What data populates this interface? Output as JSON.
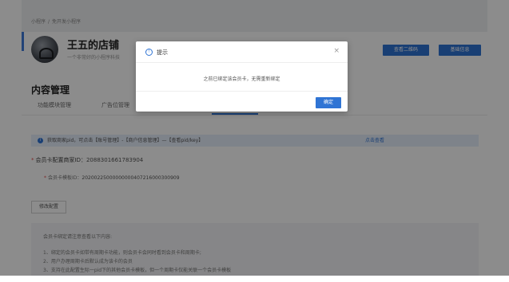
{
  "breadcrumb": {
    "root": "小程序",
    "separator": "/",
    "current": "免开发小程序"
  },
  "profile": {
    "store_name": "王五的店铺",
    "description": "一个非常好的小程序科技",
    "qr_button": "查看二维码",
    "info_button": "基础信息"
  },
  "content": {
    "title": "内容管理",
    "tabs": [
      {
        "label": "功能模块管理"
      },
      {
        "label": "广告位管理"
      }
    ],
    "notice": {
      "text": "获取商家pid，可点击【账号管理】-【商户信息管理】—【查看pid/key】",
      "link": "点击查看"
    },
    "fields": {
      "merchant_label": "会员卡配置商家ID：",
      "merchant_value": "2088301661783904",
      "template_label": "会员卡模板ID：",
      "template_value": "20200225000000000407216000300909"
    },
    "edit_button": "修改配置",
    "notes": {
      "title": "会员卡绑定请注意查看以下内容:",
      "items": [
        "1、绑定的会员卡如带有周期卡功能，则会员卡会同时看到会员卡和周期卡;",
        "2、用户办理周期卡后默认成为该卡的会员",
        "3、支持在此配置生际一pid下的其他会员卡模板，但一个周期卡仅能关联一个会员卡模板"
      ]
    }
  },
  "dialog": {
    "icon": "info-circle-icon",
    "title": "提示",
    "close_icon": "close-icon",
    "message": "之前已绑定该会员卡，无需重新绑定",
    "ok_label": "确定"
  },
  "colors": {
    "accent": "#2f74d4",
    "mask": "rgba(0,0,0,0.45)",
    "required": "#e34c4c"
  }
}
